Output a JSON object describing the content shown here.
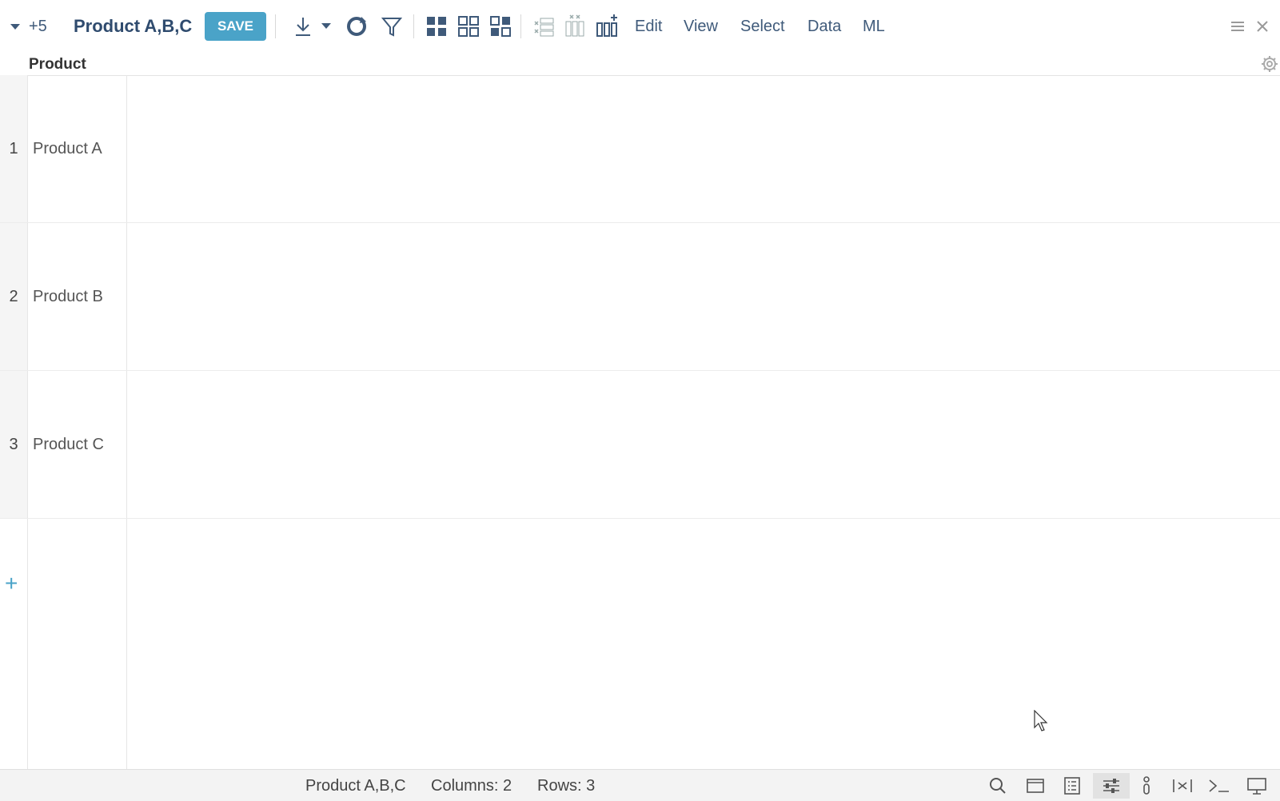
{
  "toolbar": {
    "view_count": "+5",
    "title": "Product A,B,C",
    "save_label": "SAVE"
  },
  "menus": [
    "Edit",
    "View",
    "Select",
    "Data",
    "ML"
  ],
  "column_header": "Product",
  "rows": [
    {
      "num": "1",
      "value": "Product A"
    },
    {
      "num": "2",
      "value": "Product B"
    },
    {
      "num": "3",
      "value": "Product C"
    }
  ],
  "add_row": "+",
  "status": {
    "table_name": "Product A,B,C",
    "columns": "Columns: 2",
    "rows": "Rows: 3"
  },
  "colors": {
    "accent": "#4aa3c8",
    "title": "#2f4b6e",
    "icon": "#3f5a7a"
  }
}
